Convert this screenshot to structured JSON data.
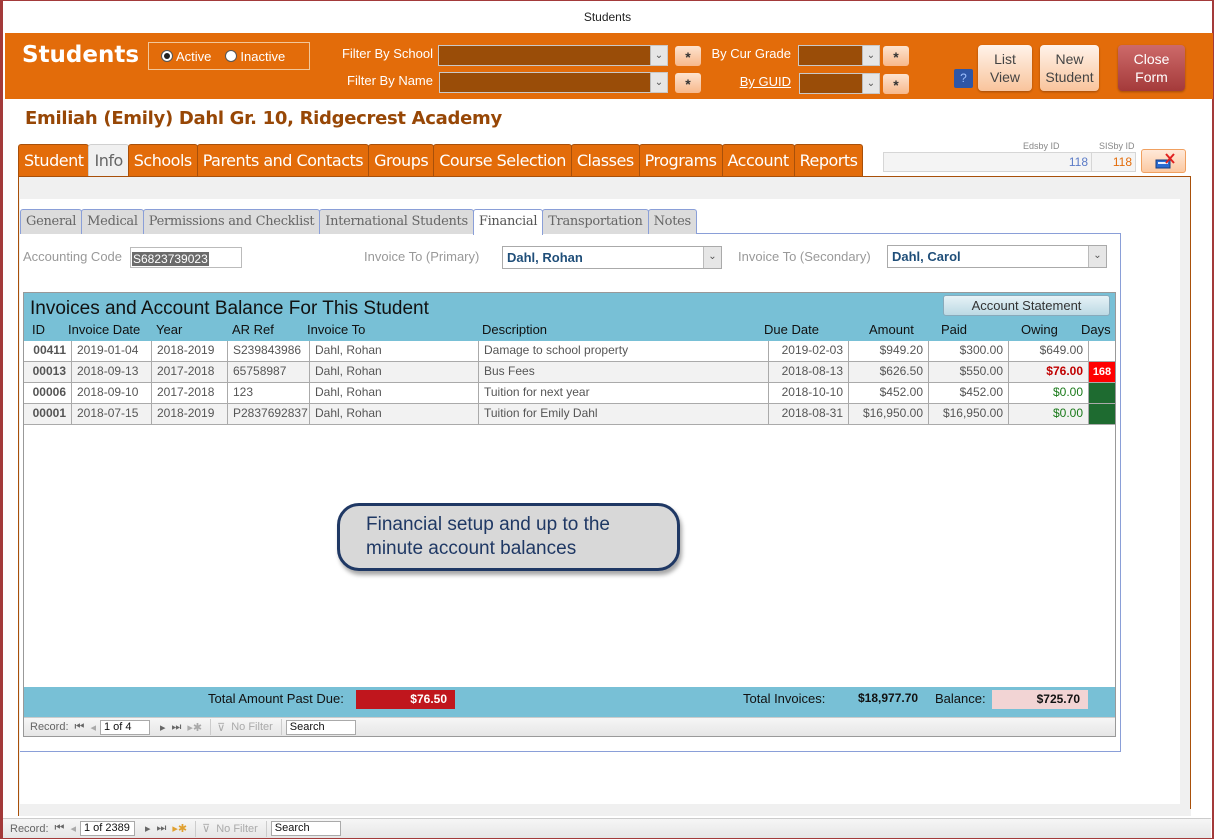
{
  "window": {
    "title": "Students"
  },
  "header": {
    "app_title": "Students",
    "status_filter": {
      "options": [
        {
          "label": "Active",
          "selected": true
        },
        {
          "label": "Inactive",
          "selected": false
        }
      ]
    },
    "filter_school_label": "Filter By School",
    "filter_name_label": "Filter By Name",
    "filter_grade_label": "By Cur Grade",
    "filter_guid_label": "By GUID",
    "filter_school_value": "",
    "filter_name_value": "",
    "filter_grade_value": "",
    "filter_guid_value": "",
    "clear_glyph": "*",
    "dropdown_glyph": "⌄",
    "help_label": "?",
    "buttons": {
      "list_view": [
        "List",
        "View"
      ],
      "new_student": [
        "New",
        "Student"
      ],
      "close_form": [
        "Close",
        "Form"
      ]
    },
    "colors": {
      "accent": "#e36c0a",
      "close": "#b04545"
    }
  },
  "student": {
    "heading": "Emiliah (Emily)  Dahl  Gr. 10, Ridgecrest Academy",
    "edsby_id_label": "Edsby ID",
    "edsby_id": "118",
    "sisby_id_label": "SISby ID",
    "sisby_id": "118"
  },
  "main_tabs": [
    {
      "label": "Student",
      "active": false
    },
    {
      "label": "Info",
      "active": true
    },
    {
      "label": "Schools",
      "active": false
    },
    {
      "label": "Parents and Contacts",
      "active": false
    },
    {
      "label": "Groups",
      "active": false
    },
    {
      "label": "Course Selection",
      "active": false
    },
    {
      "label": "Classes",
      "active": false
    },
    {
      "label": "Programs",
      "active": false
    },
    {
      "label": "Account",
      "active": false
    },
    {
      "label": "Reports",
      "active": false
    }
  ],
  "sub_tabs": [
    {
      "label": "General",
      "active": false
    },
    {
      "label": "Medical",
      "active": false
    },
    {
      "label": "Permissions and Checklist",
      "active": false
    },
    {
      "label": "International Students",
      "active": false
    },
    {
      "label": "Financial",
      "active": true
    },
    {
      "label": "Transportation",
      "active": false
    },
    {
      "label": "Notes",
      "active": false
    }
  ],
  "financial": {
    "accounting_code_label": "Accounting Code",
    "accounting_code": "S6823739023",
    "invoice_primary_label": "Invoice To (Primary)",
    "invoice_primary": "Dahl, Rohan",
    "invoice_secondary_label": "Invoice To (Secondary)",
    "invoice_secondary": "Dahl, Carol"
  },
  "invoices": {
    "title": "Invoices and Account Balance For This Student",
    "statement_button": "Account Statement",
    "columns": [
      "ID",
      "Invoice Date",
      "Year",
      "AR Ref",
      "Invoice To",
      "Description",
      "Due Date",
      "Amount",
      "Paid",
      "Owing",
      "Days"
    ],
    "rows": [
      {
        "id": "00411",
        "invoice_date": "2019-01-04",
        "year": "2018-2019",
        "ar_ref": "S239843986",
        "invoice_to": "Dahl, Rohan",
        "description": "Damage to school property",
        "due_date": "2019-02-03",
        "amount": "$949.20",
        "paid": "$300.00",
        "owing": "$649.00",
        "owing_status": "normal",
        "days": "",
        "days_status": "none"
      },
      {
        "id": "00013",
        "invoice_date": "2018-09-13",
        "year": "2017-2018",
        "ar_ref": "65758987",
        "invoice_to": "Dahl, Rohan",
        "description": "Bus  Fees",
        "due_date": "2018-08-13",
        "amount": "$626.50",
        "paid": "$550.00",
        "owing": "$76.00",
        "owing_status": "overdue",
        "days": "168",
        "days_status": "overdue"
      },
      {
        "id": "00006",
        "invoice_date": "2018-09-10",
        "year": "2017-2018",
        "ar_ref": "123",
        "invoice_to": "Dahl, Rohan",
        "description": "Tuition for next year",
        "due_date": "2018-10-10",
        "amount": "$452.00",
        "paid": "$452.00",
        "owing": "$0.00",
        "owing_status": "paid",
        "days": "",
        "days_status": "paid"
      },
      {
        "id": "00001",
        "invoice_date": "2018-07-15",
        "year": "2018-2019",
        "ar_ref": "P2837692837",
        "invoice_to": "Dahl, Rohan",
        "description": "Tuition for Emily Dahl",
        "due_date": "2018-08-31",
        "amount": "$16,950.00",
        "paid": "$16,950.00",
        "owing": "$0.00",
        "owing_status": "paid",
        "days": "",
        "days_status": "paid"
      }
    ],
    "status_colors": {
      "overdue": "#ff0000",
      "paid": "#1e6b30"
    },
    "totals": {
      "past_due_label": "Total Amount Past Due:",
      "past_due": "$76.50",
      "total_invoices_label": "Total Invoices:",
      "total_invoices": "$18,977.70",
      "balance_label": "Balance:",
      "balance": "$725.70"
    },
    "nav": {
      "record_label": "Record:",
      "position": "1 of 4",
      "filter_label": "No Filter",
      "search_label": "Search"
    }
  },
  "callout": {
    "text": "Financial setup and up to the minute account balances"
  },
  "form_nav": {
    "record_label": "Record:",
    "position": "1 of 2389",
    "filter_label": "No Filter",
    "search_label": "Search"
  }
}
